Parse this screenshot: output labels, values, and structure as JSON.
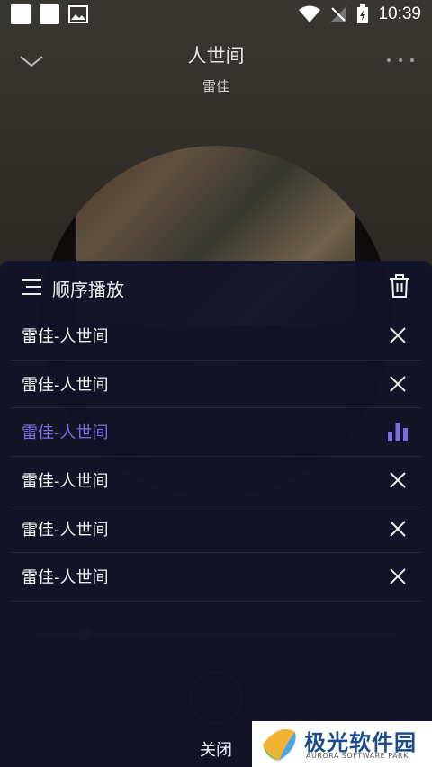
{
  "status_bar": {
    "time": "10:39"
  },
  "player": {
    "title": "人世间",
    "artist": "雷佳"
  },
  "playlist": {
    "mode_label": "顺序播放",
    "items": [
      {
        "label": "雷佳-人世间",
        "active": false
      },
      {
        "label": "雷佳-人世间",
        "active": false
      },
      {
        "label": "雷佳-人世间",
        "active": true
      },
      {
        "label": "雷佳-人世间",
        "active": false
      },
      {
        "label": "雷佳-人世间",
        "active": false
      },
      {
        "label": "雷佳-人世间",
        "active": false
      }
    ],
    "close_label": "关闭",
    "active_color": "#7d6be0"
  },
  "watermark": {
    "title": "极光软件园",
    "subtitle": "AURORA SOFTWARE PARK"
  }
}
